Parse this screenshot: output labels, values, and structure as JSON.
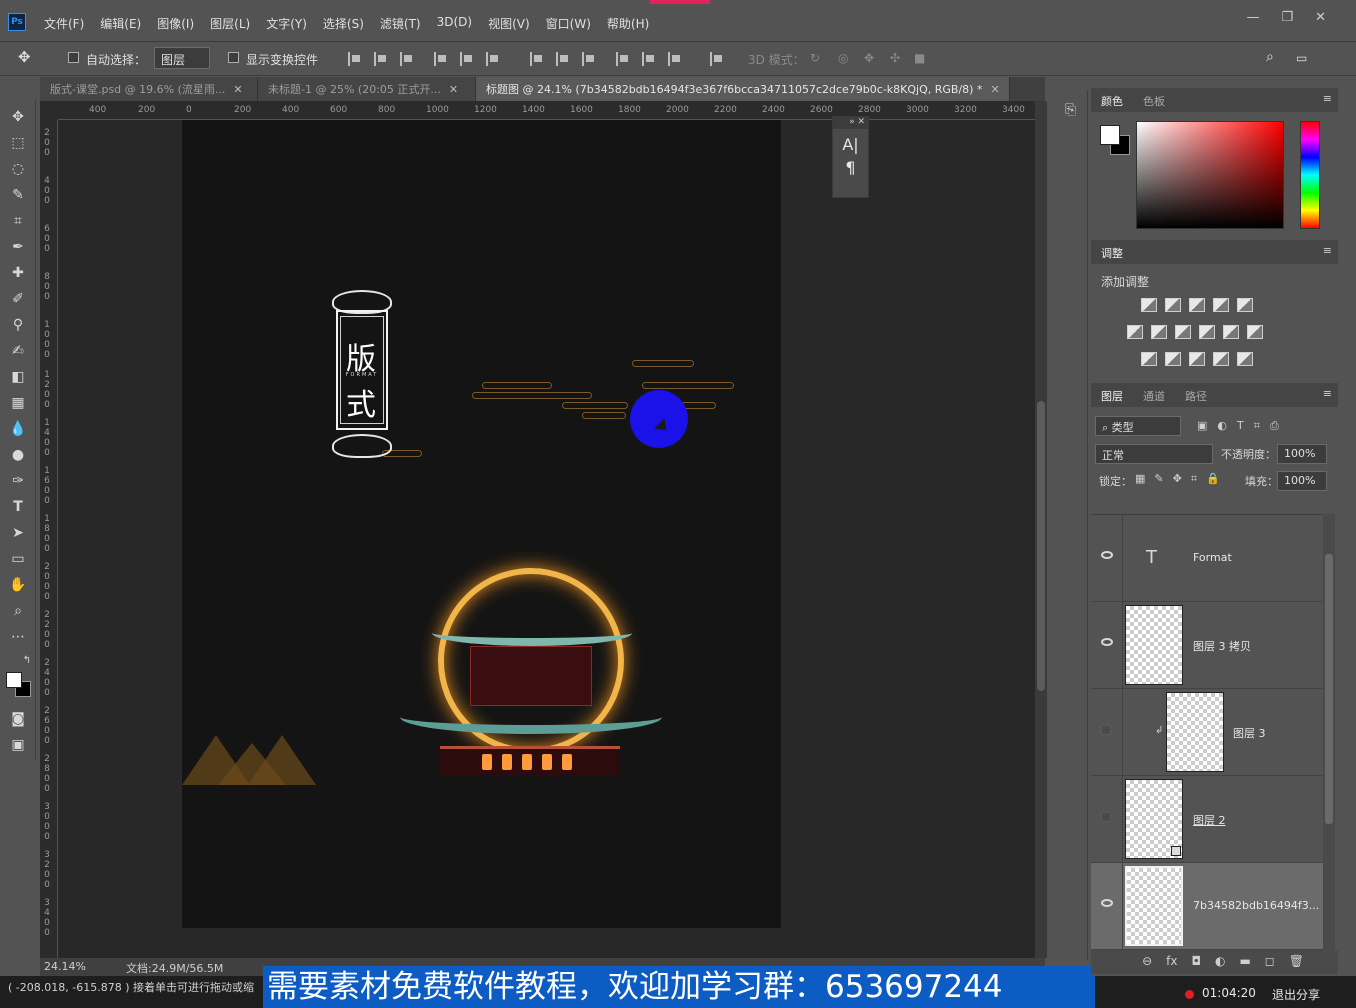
{
  "app": {
    "logo": "Ps",
    "menu": [
      "文件(F)",
      "编辑(E)",
      "图像(I)",
      "图层(L)",
      "文字(Y)",
      "选择(S)",
      "滤镜(T)",
      "3D(D)",
      "视图(V)",
      "窗口(W)",
      "帮助(H)"
    ],
    "window_controls": [
      "—",
      "❐",
      "✕"
    ]
  },
  "options": {
    "auto_select_label": "自动选择：",
    "auto_select_value": "图层",
    "show_transform_label": "显示变换控件",
    "mode_3d_label": "3D 模式："
  },
  "tabs": [
    {
      "label": "版式-课堂.psd @ 19.6% (流星雨...",
      "active": false
    },
    {
      "label": "未标题-1 @ 25% (20:05 正式开...",
      "active": false
    },
    {
      "label": "标题图 @ 24.1% (7b34582bdb16494f3e367f6bcca34711057c2dce79b0c-k8KQjQ, RGB/8) *",
      "active": true
    }
  ],
  "ruler_h": [
    "400",
    "200",
    "0",
    "200",
    "400",
    "600",
    "800",
    "1000",
    "1200",
    "1400",
    "1600",
    "1800",
    "2000",
    "2200",
    "2400",
    "2600",
    "2800",
    "3000",
    "3200",
    "3400"
  ],
  "ruler_v": [
    "2 0 0",
    "4 0 0",
    "6 0 0",
    "8 0 0",
    "1 0 0 0",
    "1 2 0 0",
    "1 4 0 0",
    "1 6 0 0",
    "1 8 0 0",
    "2 0 0 0",
    "2 2 0 0",
    "2 4 0 0",
    "2 6 0 0",
    "2 8 0 0",
    "3 0 0 0",
    "3 2 0 0",
    "3 4 0 0"
  ],
  "artwork": {
    "title_char_1": "版",
    "title_char_2": "式",
    "title_small": "FORMAT"
  },
  "char_panel": {
    "collapse": "»  ✕",
    "icon_1": "A|",
    "icon_2": "¶"
  },
  "status": {
    "zoom": "24.14%",
    "doc": "文档:24.9M/56.5M",
    "coords": "( -208.018, -615.878 )  接着单击可进行拖动或缩",
    "banner": "需要素材免费软件教程，欢迎加学习群：653697244",
    "rec_time": "01:04:20",
    "exit_share": "退出分享"
  },
  "panels": {
    "color_tabs": [
      "颜色",
      "色板"
    ],
    "adjust_tab": "调整",
    "add_adjust": "添加调整",
    "layers_tabs": [
      "图层",
      "通道",
      "路径"
    ],
    "filter_kind": "类型",
    "blend_mode": "正常",
    "opacity_label": "不透明度：",
    "opacity_value": "100%",
    "lock_label": "锁定：",
    "fill_label": "填充：",
    "fill_value": "100%",
    "menu_icon": "≡",
    "footer_icons": [
      "⊖",
      "fx",
      "◘",
      "◐",
      "▬",
      "◻",
      "🗑"
    ]
  },
  "layers": [
    {
      "name": "Format",
      "type": "text",
      "visible": true
    },
    {
      "name": "图层 3 拷贝",
      "type": "pixel",
      "visible": true
    },
    {
      "name": "图层 3",
      "type": "pixel",
      "visible": false
    },
    {
      "name": "图层 2",
      "type": "smart",
      "visible": false
    },
    {
      "name": "7b34582bdb16494f3...",
      "type": "pixel",
      "visible": true
    }
  ],
  "colors": {
    "accent_blue": "#0d5cc4",
    "dot_blue": "#1a12e8",
    "gold": "#f2b54a"
  }
}
